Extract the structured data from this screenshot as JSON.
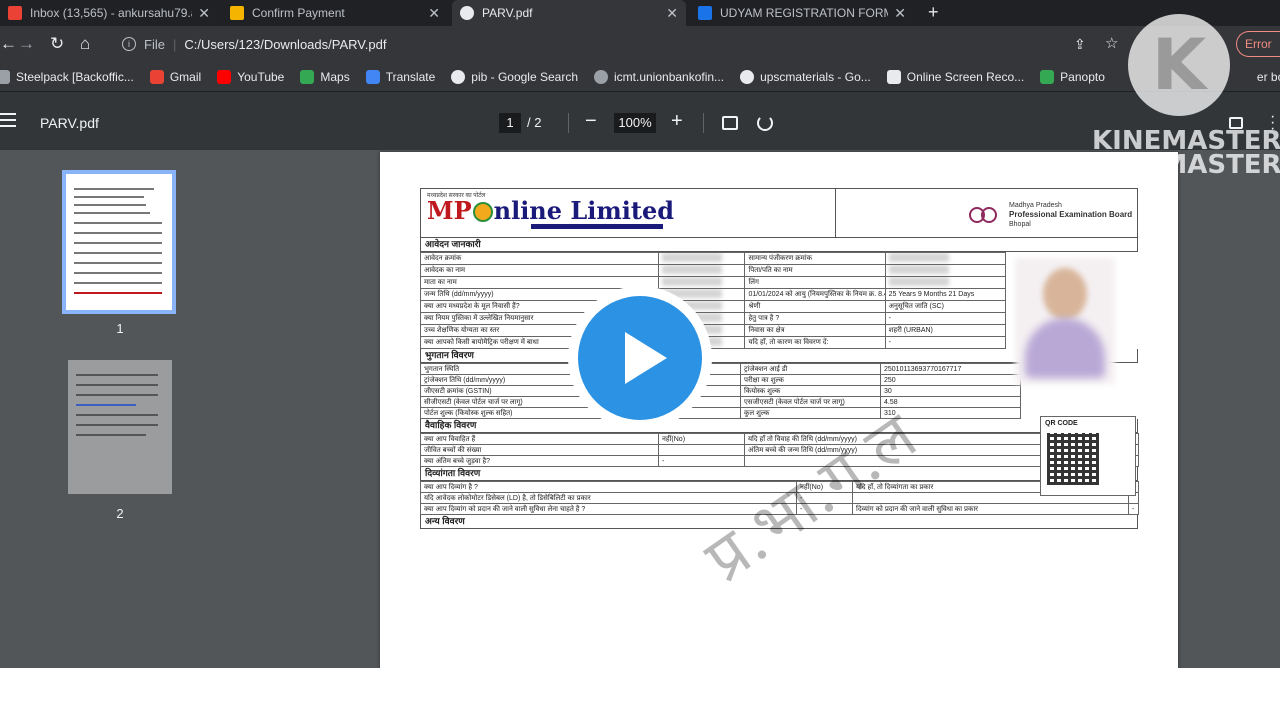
{
  "tabs": [
    {
      "title": "Inbox (13,565) - ankursahu79.as",
      "fav_color": "#ea4335",
      "active": false
    },
    {
      "title": "Confirm Payment",
      "fav_color": "#f4b400",
      "active": false
    },
    {
      "title": "PARV.pdf",
      "fav_color": "#e8eaed",
      "active": true
    },
    {
      "title": "UDYAM REGISTRATION FORM - ",
      "fav_color": "#1a73e8",
      "active": false
    }
  ],
  "new_tab": "+",
  "address": {
    "protocol_label": "File",
    "url": "C:/Users/123/Downloads/PARV.pdf",
    "error_label": "Error"
  },
  "bookmarks": [
    {
      "label": "Steelpack [Backoffic...",
      "color": "#9aa0a6"
    },
    {
      "label": "Gmail",
      "color": "#ea4335"
    },
    {
      "label": "YouTube",
      "color": "#ff0000"
    },
    {
      "label": "Maps",
      "color": "#34a853"
    },
    {
      "label": "Translate",
      "color": "#4285f4"
    },
    {
      "label": "pib - Google Search",
      "color": "#e8eaed"
    },
    {
      "label": "icmt.unionbankofin...",
      "color": "#9aa0a6"
    },
    {
      "label": "upscmaterials - Go...",
      "color": "#e8eaed"
    },
    {
      "label": "Online Screen Reco...",
      "color": "#e8eaed"
    },
    {
      "label": "Panopto",
      "color": "#34a853"
    },
    {
      "label": "er bookma",
      "color": "#f4b400"
    }
  ],
  "pdf_toolbar": {
    "title": "PARV.pdf",
    "current_page": "1",
    "total_pages": "/  2",
    "zoom": "100%",
    "minus": "−",
    "plus": "+"
  },
  "thumbnails": [
    {
      "num": "1"
    },
    {
      "num": "2"
    }
  ],
  "doc": {
    "gov_line": "मध्यप्रदेश सरकार का पोर्टल",
    "mp": "MP",
    "online": "nline Limited",
    "peb_line1": "Madhya Pradesh",
    "peb_line2": "Professional Examination Board",
    "peb_line3": "Bhopal",
    "sec_application": "आवेदन जानकारी",
    "application_rows": [
      [
        "आवेदन क्रमांक",
        "",
        "सामान्य पंजीकरण क्रमांक",
        ""
      ],
      [
        "आवेदक का नाम",
        "",
        "पिता/पति का नाम",
        ""
      ],
      [
        "माता का नाम",
        "",
        "लिंग",
        ""
      ],
      [
        "जन्म तिथि (dd/mm/yyyy)",
        "",
        "01/01/2024 को आयु (नियमपुस्तिका के नियम क्र. 8.4 )",
        "25 Years 9 Months 21 Days"
      ],
      [
        "क्या आप मध्यप्रदेश के मूल निवासी हैं?",
        "",
        "श्रेणी",
        "अनुसूचित जाति (SC)"
      ],
      [
        "क्या नियम पुस्तिका में उल्लेखित नियमानुसार",
        "",
        "हेतु पात्र है ?",
        "-"
      ],
      [
        "उच्च शैक्षणिक योग्यता का स्तर",
        "",
        "निवास का क्षेत्र",
        "शहरी (URBAN)"
      ],
      [
        "क्या आपको किसी बायोमैट्रिक परीक्षण में बाधा",
        "",
        "यदि हाँ, तो कारण का विवरण दें:",
        "-"
      ]
    ],
    "sec_payment": "भुगतान विवरण",
    "payment_rows": [
      [
        "भुगतान स्थिति",
        "",
        "ट्रांजेक्शन आई डी",
        "25010113693770167717"
      ],
      [
        "ट्रांजेक्शन तिथि (dd/mm/yyyy)",
        "10/01/2025 14:05:13",
        "परीक्षा का शुल्क",
        "250"
      ],
      [
        "जीएसटी क्रमांक (GSTIN)",
        "23AAECM7539B1ZQ",
        "कियोस्क शुल्क",
        "30"
      ],
      [
        "सीजीएसटी (केवल पोर्टल चार्ज पर लागू)",
        "4.58",
        "एसजीएसटी (केवल पोर्टल चार्ज पर लागू)",
        "4.58"
      ],
      [
        "पोर्टल शुल्क (कियोस्क शुल्क सहित)",
        "50.84",
        "कुल शुल्क",
        "310"
      ]
    ],
    "qr_label": "QR CODE",
    "sec_marital": "वैवाहिक विवरण",
    "marital_rows": [
      [
        "क्या आप विवाहित हैं",
        "नहीं(No)",
        "यदि हाँ तो विवाह की तिथि (dd/mm/yyyy)",
        "-"
      ],
      [
        "जीवित बच्चों की संख्या",
        "",
        "अंतिम बच्चे की जन्म तिथि (dd/mm/yyyy)",
        "-"
      ],
      [
        "क्या अंतिम बच्चे जुड़वा है?",
        "-",
        "",
        ""
      ]
    ],
    "sec_disability": "दिव्यांगता विवरण",
    "disability_rows": [
      [
        "क्या आप दिव्यांग है ?",
        "नहीं(No)",
        "यदि हाँ, तो दिव्यांगता का प्रकार",
        "-"
      ],
      [
        "यदि आवेदक लोकोमोटर डिसेबल (LD) है, तो डिसेबिलिटी का प्रकार",
        "-",
        "",
        ""
      ],
      [
        "क्या आप दिव्यांग को प्रदान की जाने वाली सुविधा लेना चाहते है ?",
        "-",
        "दिव्यांग को प्रदान की जाने वाली सुविधा का प्रकार",
        "-"
      ]
    ],
    "sec_other": "अन्य विवरण",
    "watermark": "प्र.भा.ग.ल"
  },
  "kinemaster": {
    "text1": "KINEMASTER",
    "text2": "KINEMASTER"
  },
  "colors": {
    "accent": "#8ab4f8",
    "play": "#2b92e4"
  }
}
